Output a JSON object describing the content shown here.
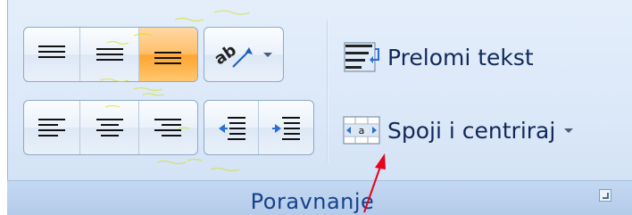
{
  "group": {
    "label": "Poravnanje"
  },
  "buttons": {
    "wrap_text_label": "Prelomi tekst",
    "merge_center_label": "Spoji i centriraj"
  },
  "icons": {
    "align_top": "align-top-icon",
    "align_middle": "align-middle-icon",
    "align_bottom": "align-bottom-icon",
    "orientation": "text-orientation-icon",
    "align_left": "align-left-icon",
    "align_center": "align-center-icon",
    "align_right": "align-right-icon",
    "decrease_indent": "decrease-indent-icon",
    "increase_indent": "increase-indent-icon",
    "wrap_text": "wrap-text-icon",
    "merge_center": "merge-center-icon",
    "dialog_launcher": "dialog-launcher-icon"
  },
  "colors": {
    "active_highlight": "#ffb347",
    "ribbon_text": "#15428b",
    "annotation_arrow": "#e8001c"
  }
}
